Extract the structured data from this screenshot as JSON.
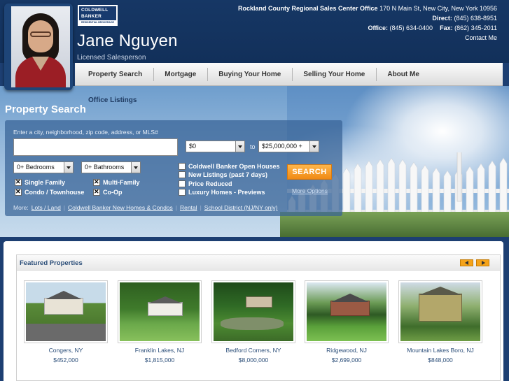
{
  "agent": {
    "name": "Jane Nguyen",
    "title": "Licensed Salesperson"
  },
  "logo": {
    "line1": "COLDWELL",
    "line2": "BANKER",
    "sub": "RESIDENTIAL BROKERAGE"
  },
  "contact": {
    "office_name": "Rockland County Regional Sales Center Office",
    "address": "170 N Main St, New City, New York 10956",
    "direct_label": "Direct:",
    "direct": "(845) 638-8951",
    "office_label": "Office:",
    "office": "(845) 634-0400",
    "fax_label": "Fax:",
    "fax": "(862) 345-2011",
    "contact_me": "Contact Me"
  },
  "nav": {
    "items": [
      "Property Search",
      "Mortgage",
      "Buying Your Home",
      "Selling Your Home",
      "About Me"
    ],
    "office_listings": "Office Listings"
  },
  "search": {
    "title": "Property Search",
    "hint": "Enter a city, neighborhood, zip code, address, or MLS#",
    "input_value": "",
    "price_min": "$0",
    "price_to": "to",
    "price_max": "$25,000,000 +",
    "bedrooms": "0+ Bedrooms",
    "bathrooms": "0+ Bathrooms",
    "types": [
      {
        "label": "Single Family",
        "checked": true
      },
      {
        "label": "Multi-Family",
        "checked": true
      },
      {
        "label": "Condo / Townhouse",
        "checked": true
      },
      {
        "label": "Co-Op",
        "checked": true
      }
    ],
    "filters": [
      {
        "label": "Coldwell Banker Open Houses",
        "checked": false
      },
      {
        "label": "New Listings (past 7 days)",
        "checked": false
      },
      {
        "label": "Price Reduced",
        "checked": false
      },
      {
        "label": "Luxury Homes - Previews",
        "checked": false
      }
    ],
    "button": "SEARCH",
    "more_options": "More Options",
    "more_label": "More:",
    "more_links": [
      "Lots / Land",
      "Coldwell Banker New Homes & Condos",
      "Rental",
      "School District (NJ/NY only)"
    ]
  },
  "featured": {
    "title": "Featured Properties",
    "properties": [
      {
        "city": "Congers, NY",
        "price": "$452,000"
      },
      {
        "city": "Franklin Lakes, NJ",
        "price": "$1,815,000"
      },
      {
        "city": "Bedford Corners, NY",
        "price": "$8,000,000"
      },
      {
        "city": "Ridgewood, NJ",
        "price": "$2,699,000"
      },
      {
        "city": "Mountain Lakes Boro, NJ",
        "price": "$848,000"
      }
    ]
  }
}
